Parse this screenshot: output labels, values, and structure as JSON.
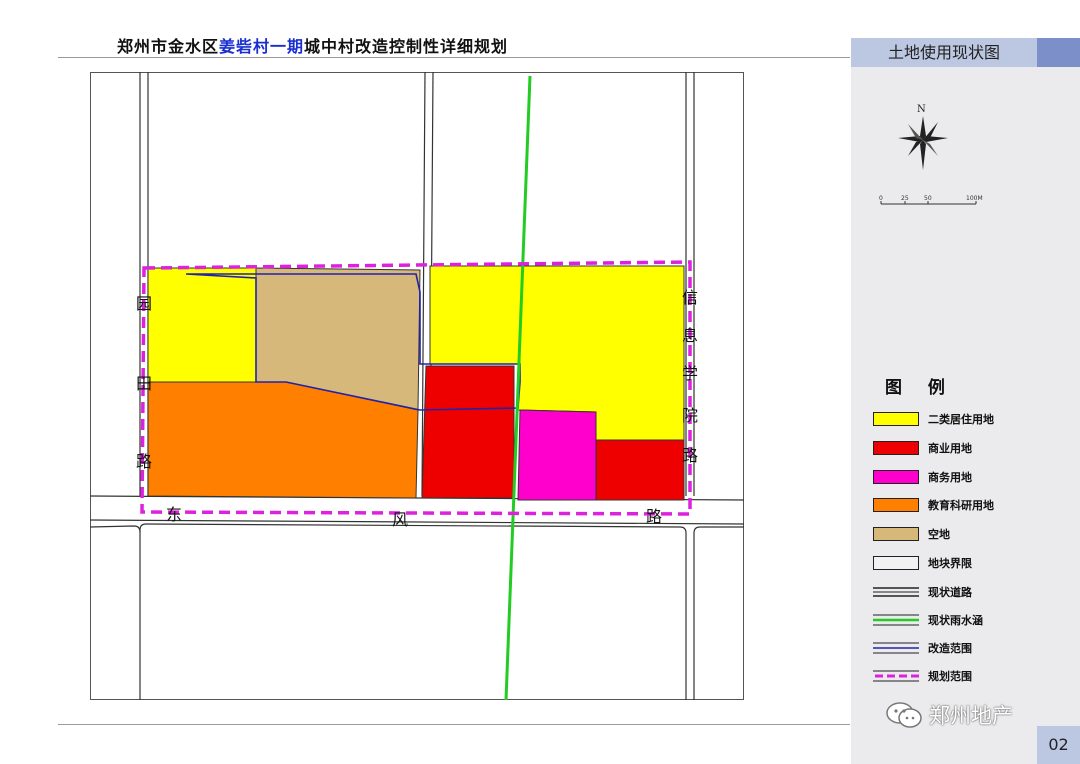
{
  "header": {
    "title_prefix": "郑州市金水区",
    "title_highlight": "姜砦村一期",
    "title_suffix": "城中村改造控制性详细规划"
  },
  "panel": {
    "title": "土地使用现状图",
    "page_number": "02"
  },
  "compass": {
    "north_label": "N"
  },
  "scale_bar": {
    "ticks": [
      "0",
      "25",
      "50",
      "100M"
    ]
  },
  "roads": {
    "west": [
      "园",
      "田",
      "路"
    ],
    "south": [
      "东",
      "风",
      "路"
    ],
    "east": [
      "信",
      "息",
      "学",
      "院",
      "路"
    ]
  },
  "legend": {
    "title": "图  例",
    "items": [
      {
        "label": "二类居住用地",
        "color": "#ffff00",
        "kind": "fill"
      },
      {
        "label": "商业用地",
        "color": "#ee0000",
        "kind": "fill"
      },
      {
        "label": "商务用地",
        "color": "#ff00cc",
        "kind": "fill"
      },
      {
        "label": "教育科研用地",
        "color": "#ff7f00",
        "kind": "fill"
      },
      {
        "label": "空地",
        "color": "#d6b97a",
        "kind": "fill"
      },
      {
        "label": "地块界限",
        "color": "#f2f2f2",
        "kind": "fill"
      },
      {
        "label": "现状道路",
        "color": "#222222",
        "kind": "road"
      },
      {
        "label": "现状雨水涵",
        "color": "#22cc22",
        "kind": "green-line"
      },
      {
        "label": "改造范围",
        "color": "#2222aa",
        "kind": "blue-line"
      },
      {
        "label": "规划范围",
        "color": "#dd22dd",
        "kind": "dash-line"
      }
    ]
  },
  "watermark": {
    "text": "郑州地产"
  }
}
